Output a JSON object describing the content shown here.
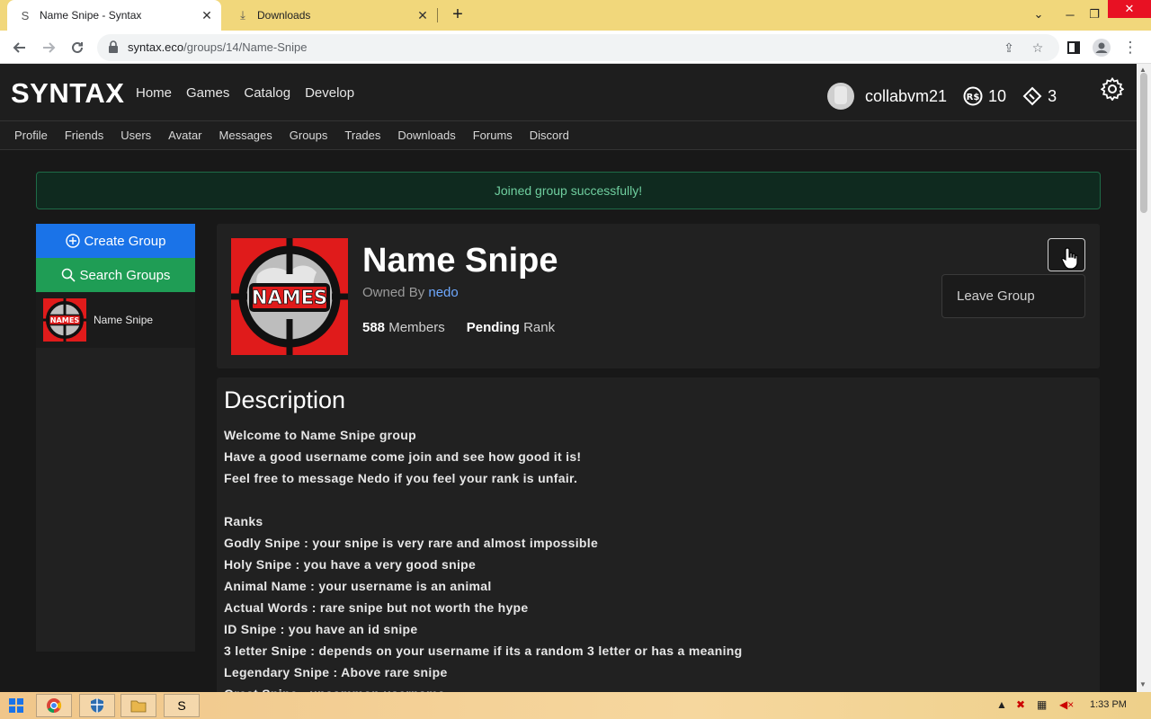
{
  "browser": {
    "tabs": [
      {
        "title": "Name Snipe - Syntax",
        "icon": "syntax-favicon",
        "favicon_glyph": "S",
        "active": true
      },
      {
        "title": "Downloads",
        "icon": "download-icon",
        "favicon_glyph": "⤓",
        "active": false
      }
    ],
    "url_host": "syntax.eco",
    "url_path": "/groups/14/Name-Snipe"
  },
  "site": {
    "logo": "SYNTAX",
    "main_nav": [
      "Home",
      "Games",
      "Catalog",
      "Develop"
    ],
    "username": "collabvm21",
    "robux": "10",
    "tickets": "3",
    "sub_nav": [
      "Profile",
      "Friends",
      "Users",
      "Avatar",
      "Messages",
      "Groups",
      "Trades",
      "Downloads",
      "Forums",
      "Discord"
    ]
  },
  "alert": "Joined group successfully!",
  "sidebar": {
    "create_label": "Create Group",
    "search_label": "Search Groups",
    "groups": [
      {
        "name": "Name Snipe"
      }
    ]
  },
  "group": {
    "name": "Name Snipe",
    "owned_by_label": "Owned By",
    "owner": "nedo",
    "members_count": "588",
    "members_label": "Members",
    "rank_value": "Pending",
    "rank_label": "Rank",
    "dropdown_item": "Leave Group",
    "logo_text": "NAMES"
  },
  "description": {
    "title": "Description",
    "lines": [
      "Welcome to Name Snipe group",
      "Have a good username come join and see how good it is!",
      "Feel free to message Nedo if you feel your rank is unfair.",
      "",
      "Ranks",
      "Godly Snipe : your snipe is very rare and almost impossible",
      "Holy Snipe : you have a very good snipe",
      "Animal Name : your username is an animal",
      "Actual Words : rare snipe but not worth the hype",
      "ID Snipe : you have an id snipe",
      "3 letter Snipe : depends on your username if its a random 3 letter or has a meaning",
      "Legendary Snipe : Above rare snipe",
      "Great Snipe : uncommon username"
    ]
  },
  "taskbar": {
    "clock": "1:33 PM"
  },
  "colors": {
    "tabbar": "#f1d77b",
    "create_button": "#1a73e8",
    "search_button": "#1f9d55",
    "alert_text": "#6fcf9f",
    "owner_link": "#6ea8fe"
  }
}
